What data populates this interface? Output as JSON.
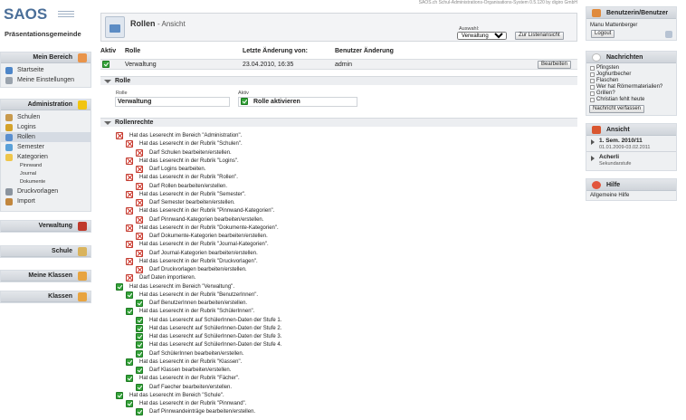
{
  "system_info": "SAOS.ch Schul-Administrations-Organisations-System 0.5.120 by digiro GmbH",
  "logo": {
    "name": "SAOS",
    "subtitle": "Präsentationsgemeinde"
  },
  "left_sidebar": {
    "mein_bereich": {
      "title": "Mein Bereich",
      "items": [
        "Startseite",
        "Meine Einstellungen"
      ]
    },
    "administration": {
      "title": "Administration",
      "items": [
        "Schulen",
        "Logins",
        "Rollen",
        "Semester",
        "Kategorien"
      ],
      "kategorien_sub": [
        "Pinnwand",
        "Journal",
        "Dokumente"
      ],
      "items_after": [
        "Druckvorlagen",
        "Import"
      ]
    },
    "collapsed": [
      "Verwaltung",
      "Schule",
      "Meine Klassen",
      "Klassen"
    ]
  },
  "header": {
    "title": "Rollen",
    "suffix": "- Ansicht",
    "auswahl_label": "Auswahl:",
    "auswahl_value": "Verwaltung",
    "list_button": "Zur Listenansicht"
  },
  "role_table": {
    "columns": [
      "Aktiv",
      "Rolle",
      "Letzte Änderung von:",
      "Benutzer Änderung"
    ],
    "row": {
      "rolle": "Verwaltung",
      "changed": "23.04.2010, 16:35",
      "user": "admin",
      "edit_button": "Bearbeiten"
    }
  },
  "rolle_section": {
    "title": "Rolle",
    "rolle_label": "Rolle",
    "rolle_value": "Verwaltung",
    "aktiv_label": "Aktiv",
    "aktiv_value": "Rolle aktivieren"
  },
  "rechte_section": {
    "title": "Rollenrechte",
    "permissions": [
      {
        "level": 0,
        "allowed": false,
        "text": "Hat das Leserecht im Bereich \"Administration\"."
      },
      {
        "level": 1,
        "allowed": false,
        "text": "Hat das Leserecht in der Rubrik \"Schulen\"."
      },
      {
        "level": 2,
        "allowed": false,
        "text": "Darf Schulen bearbeiten/erstellen."
      },
      {
        "level": 1,
        "allowed": false,
        "text": "Hat das Leserecht in der Rubrik \"Logins\"."
      },
      {
        "level": 2,
        "allowed": false,
        "text": "Darf Logins bearbeiten."
      },
      {
        "level": 1,
        "allowed": false,
        "text": "Hat das Leserecht in der Rubrik \"Rollen\"."
      },
      {
        "level": 2,
        "allowed": false,
        "text": "Darf Rollen bearbeiten/erstellen."
      },
      {
        "level": 1,
        "allowed": false,
        "text": "Hat das Leserecht in der Rubrik \"Semester\"."
      },
      {
        "level": 2,
        "allowed": false,
        "text": "Darf Semester bearbeiten/erstellen."
      },
      {
        "level": 1,
        "allowed": false,
        "text": "Hat das Leserecht in der Rubrik \"Pinnwand-Kategorien\"."
      },
      {
        "level": 2,
        "allowed": false,
        "text": "Darf Pinnwand-Kategorien bearbeiten/erstellen."
      },
      {
        "level": 1,
        "allowed": false,
        "text": "Hat das Leserecht in der Rubrik \"Dokumente-Kategorien\"."
      },
      {
        "level": 2,
        "allowed": false,
        "text": "Darf Dokumente-Kategorien bearbeiten/erstellen."
      },
      {
        "level": 1,
        "allowed": false,
        "text": "Hat das Leserecht in der Rubrik \"Journal-Kategorien\"."
      },
      {
        "level": 2,
        "allowed": false,
        "text": "Darf Journal-Kategorien bearbeiten/erstellen."
      },
      {
        "level": 1,
        "allowed": false,
        "text": "Hat das Leserecht in der Rubrik \"Druckvorlagen\"."
      },
      {
        "level": 2,
        "allowed": false,
        "text": "Darf Druckvorlagen bearbeiten/erstellen."
      },
      {
        "level": 1,
        "allowed": false,
        "text": "Darf Daten importieren."
      },
      {
        "level": 0,
        "allowed": true,
        "text": "Hat das Leserecht im Bereich \"Verwaltung\"."
      },
      {
        "level": 1,
        "allowed": true,
        "text": "Hat das Leserecht in der Rubrik \"BenutzerInnen\"."
      },
      {
        "level": 2,
        "allowed": true,
        "text": "Darf BenutzerInnen bearbeiten/erstellen."
      },
      {
        "level": 1,
        "allowed": true,
        "text": "Hat das Leserecht in der Rubrik \"SchülerInnen\"."
      },
      {
        "level": 2,
        "allowed": true,
        "text": "Hat das Leserecht auf SchülerInnen-Daten der Stufe 1."
      },
      {
        "level": 2,
        "allowed": true,
        "text": "Hat das Leserecht auf SchülerInnen-Daten der Stufe 2."
      },
      {
        "level": 2,
        "allowed": true,
        "text": "Hat das Leserecht auf SchülerInnen-Daten der Stufe 3."
      },
      {
        "level": 2,
        "allowed": true,
        "text": "Hat das Leserecht auf SchülerInnen-Daten der Stufe 4."
      },
      {
        "level": 2,
        "allowed": true,
        "text": "Darf SchülerInnen bearbeiten/erstellen."
      },
      {
        "level": 1,
        "allowed": true,
        "text": "Hat das Leserecht in der Rubrik \"Klassen\"."
      },
      {
        "level": 2,
        "allowed": true,
        "text": "Darf Klassen bearbeiten/erstellen."
      },
      {
        "level": 1,
        "allowed": true,
        "text": "Hat das Leserecht in der Rubrik \"Fächer\"."
      },
      {
        "level": 2,
        "allowed": true,
        "text": "Darf Faecher bearbeiten/erstellen."
      },
      {
        "level": 0,
        "allowed": true,
        "text": "Hat das Leserecht im Bereich \"Schule\"."
      },
      {
        "level": 1,
        "allowed": true,
        "text": "Hat das Leserecht in der Rubrik \"Pinnwand\"."
      },
      {
        "level": 2,
        "allowed": true,
        "text": "Darf Pinnwandeinträge bearbeiten/erstellen."
      }
    ]
  },
  "right_sidebar": {
    "user": {
      "title": "Benutzerin/Benutzer",
      "name": "Manu Mattenberger",
      "logout": "Logout"
    },
    "news": {
      "title": "Nachrichten",
      "items": [
        "Pfingsten",
        "Joghurtbecher",
        "Flaschen",
        "Wer hat Römermaterialien?",
        "Grillen?",
        "Christian fehlt heute"
      ],
      "button": "Nachricht verfassen"
    },
    "ansicht": {
      "title": "Ansicht",
      "semester": "1. Sem. 2010/11",
      "semester_dates": "01.01.2009-03.02.2011",
      "school": "Acherli",
      "school_level": "Sekundarstufe"
    },
    "hilfe": {
      "title": "Hilfe",
      "text": "Allgemeine Hilfe"
    }
  }
}
